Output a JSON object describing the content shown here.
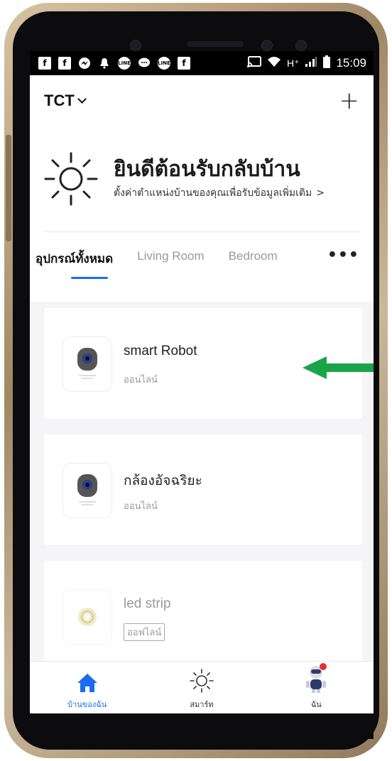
{
  "status_bar": {
    "icons": [
      "facebook-icon",
      "facebook-icon",
      "messenger-icon",
      "bell-icon",
      "line-icon",
      "line-icon",
      "facebook-icon"
    ],
    "right_icons": [
      "cast-icon",
      "wifi-icon",
      "signal-icon",
      "battery-icon"
    ],
    "network": "H⁺",
    "time": "15:09"
  },
  "header": {
    "home_name": "TCT",
    "add_label": "+"
  },
  "welcome": {
    "title": "ยินดีต้อนรับกลับบ้าน",
    "subtitle": "ตั้งค่าตำแหน่งบ้านของคุณเพื่อรับข้อมูลเพิ่มเติม",
    "arrow": ">"
  },
  "tabs": {
    "items": [
      {
        "label": "อุปกรณ์ทั้งหมด",
        "active": true
      },
      {
        "label": "Living Room",
        "active": false
      },
      {
        "label": "Bedroom",
        "active": false
      }
    ],
    "more": "•••"
  },
  "devices": [
    {
      "name": "smart Robot",
      "status": "ออนไลน์",
      "online": true,
      "icon": "camera-icon"
    },
    {
      "name": "กล้องอัจฉริยะ",
      "status": "ออนไลน์",
      "online": true,
      "icon": "camera-icon"
    },
    {
      "name": "led strip",
      "status": "ออฟไลน์",
      "online": false,
      "icon": "led-strip-icon"
    }
  ],
  "bottom_nav": [
    {
      "label": "บ้านของฉัน",
      "icon": "home-icon",
      "active": true
    },
    {
      "label": "สมาร์ท",
      "icon": "sun-icon",
      "active": false
    },
    {
      "label": "ฉัน",
      "icon": "robot-avatar-icon",
      "active": false
    }
  ],
  "colors": {
    "accent": "#1a6cf0",
    "annotation_arrow": "#1aa34a"
  }
}
